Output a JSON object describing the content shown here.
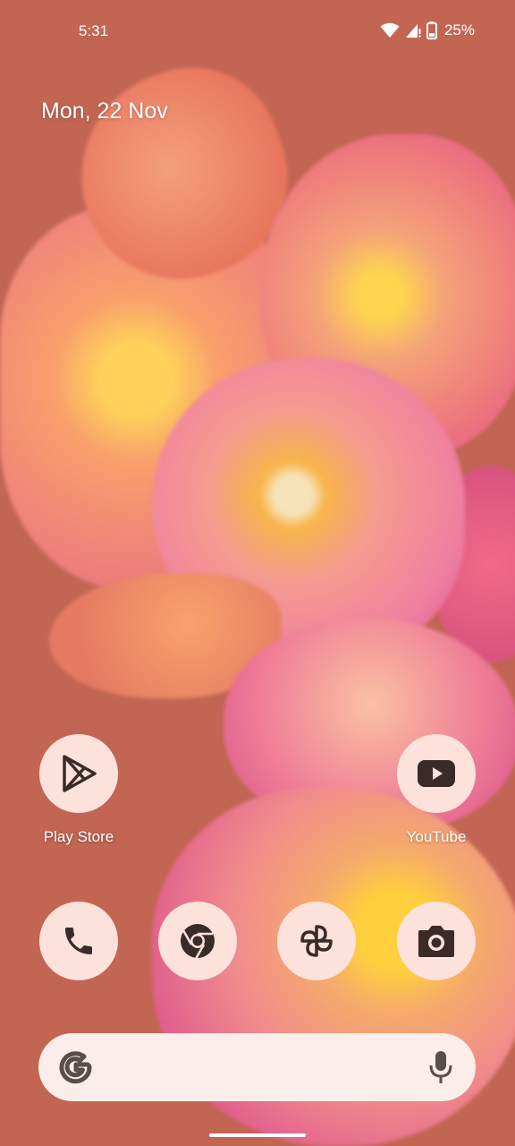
{
  "status_bar": {
    "time": "5:31",
    "battery": "25%",
    "icons": [
      "wifi-icon",
      "signal-icon",
      "battery-icon"
    ]
  },
  "date_widget": {
    "text": "Mon, 22 Nov"
  },
  "apps": {
    "play_store": {
      "label": "Play Store",
      "icon": "play-store-icon"
    },
    "youtube": {
      "label": "YouTube",
      "icon": "youtube-icon"
    }
  },
  "dock": [
    {
      "name": "phone",
      "icon": "phone-icon"
    },
    {
      "name": "chrome",
      "icon": "chrome-icon"
    },
    {
      "name": "photos",
      "icon": "pinwheel-icon"
    },
    {
      "name": "camera",
      "icon": "camera-icon"
    }
  ],
  "search": {
    "placeholder": "",
    "icons": [
      "google-g-icon",
      "microphone-icon"
    ]
  },
  "colors": {
    "icon_background": "#fde2dc",
    "icon_glyph": "#3b2b28",
    "wallpaper_base": "#c26553"
  }
}
